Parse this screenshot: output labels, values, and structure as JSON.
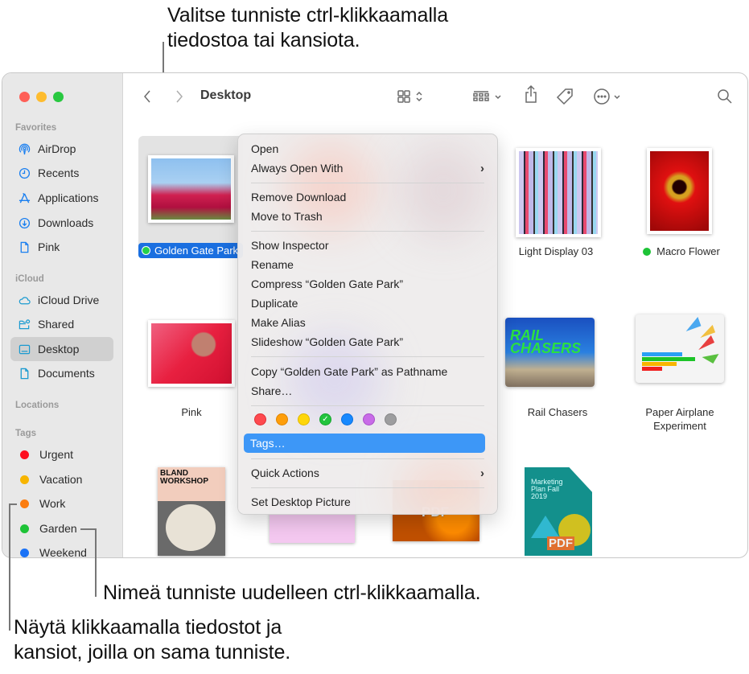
{
  "callouts": {
    "top": "Valitse tunniste ctrl-klikkaamalla tiedostoa tai kansiota.",
    "middle": "Nimeä tunniste uudelleen ctrl-klikkaamalla.",
    "bottom": "Näytä klikkaamalla tiedostot ja kansiot, joilla on sama tunniste."
  },
  "window": {
    "title": "Desktop",
    "toolbar": {
      "back": "back-icon",
      "forward": "forward-icon",
      "view": "icon-view-icon",
      "group": "group-icon",
      "share": "share-icon",
      "tag": "tag-icon",
      "more": "more-icon",
      "search": "search-icon"
    }
  },
  "sidebar": {
    "favorites_label": "Favorites",
    "favorites": [
      {
        "label": "AirDrop",
        "icon": "airdrop-icon"
      },
      {
        "label": "Recents",
        "icon": "clock-icon"
      },
      {
        "label": "Applications",
        "icon": "applications-icon"
      },
      {
        "label": "Downloads",
        "icon": "download-icon"
      },
      {
        "label": "Pink",
        "icon": "document-icon"
      }
    ],
    "icloud_label": "iCloud",
    "icloud": [
      {
        "label": "iCloud Drive",
        "icon": "cloud-icon"
      },
      {
        "label": "Shared",
        "icon": "shared-folder-icon"
      },
      {
        "label": "Desktop",
        "icon": "desktop-icon",
        "selected": true
      },
      {
        "label": "Documents",
        "icon": "document-icon"
      }
    ],
    "locations_label": "Locations",
    "tags_label": "Tags",
    "tags": [
      {
        "label": "Urgent",
        "color": "#fe0f1f"
      },
      {
        "label": "Vacation",
        "color": "#f7b500"
      },
      {
        "label": "Work",
        "color": "#fb7c0f"
      },
      {
        "label": "Garden",
        "color": "#1ec337"
      },
      {
        "label": "Weekend",
        "color": "#1a72f6"
      }
    ]
  },
  "files": [
    {
      "name": "Golden Gate Park",
      "tagged": true,
      "selected": true
    },
    {
      "name": "Light Display 03",
      "tagged": false
    },
    {
      "name": "Macro Flower",
      "tagged": true
    },
    {
      "name": "Pink",
      "tagged": false
    },
    {
      "name": "Rail Chasers",
      "tagged": false
    },
    {
      "name": "Paper Airplane Experiment",
      "tagged": false
    },
    {
      "name": "Bland Workshop",
      "tagged": false
    },
    {
      "name": "Marketing Plan Fall 2019",
      "tagged": false
    }
  ],
  "thumb_text": {
    "bland": "BLAND WORKSHOP",
    "marketing": "Marketing Plan Fall 2019",
    "pdf": "PDF"
  },
  "context_menu": {
    "items": [
      {
        "label": "Open"
      },
      {
        "label": "Always Open With",
        "submenu": true
      },
      {
        "label": "Remove Download"
      },
      {
        "label": "Move to Trash"
      },
      {
        "label": "Show Inspector"
      },
      {
        "label": "Rename"
      },
      {
        "label": "Compress “Golden Gate Park”"
      },
      {
        "label": "Duplicate"
      },
      {
        "label": "Make Alias"
      },
      {
        "label": "Slideshow “Golden Gate Park”"
      },
      {
        "label": "Copy “Golden Gate Park” as Pathname"
      },
      {
        "label": "Share…"
      },
      {
        "label": "Tags…",
        "highlighted": true
      },
      {
        "label": "Quick Actions",
        "submenu": true
      },
      {
        "label": "Set Desktop Picture"
      }
    ],
    "tag_colors": [
      {
        "name": "red",
        "color": "#fe4a4f",
        "checked": false
      },
      {
        "name": "orange",
        "color": "#fe9e0a",
        "checked": false
      },
      {
        "name": "yellow",
        "color": "#fed60a",
        "checked": false
      },
      {
        "name": "green",
        "color": "#22c43e",
        "checked": true
      },
      {
        "name": "blue",
        "color": "#1888fe",
        "checked": false
      },
      {
        "name": "purple",
        "color": "#c86be8",
        "checked": false
      },
      {
        "name": "gray",
        "color": "#9d9d9f",
        "checked": false
      }
    ],
    "check_glyph": "✓",
    "chevron_glyph": "›"
  }
}
